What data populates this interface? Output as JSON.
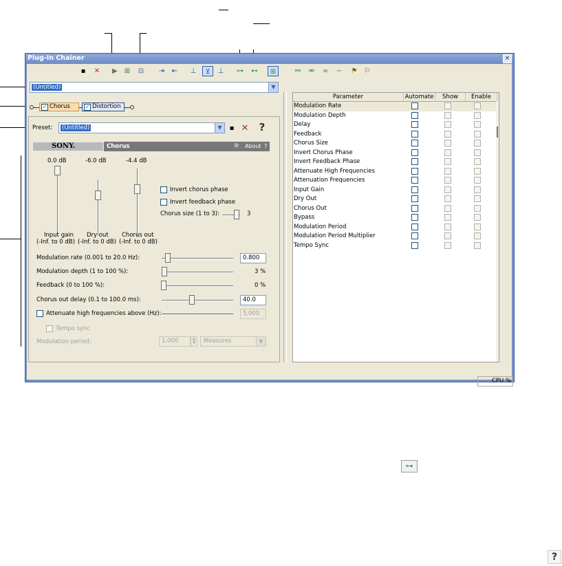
{
  "window": {
    "title": "Plug-In Chainer",
    "close": "×"
  },
  "chain": {
    "preset_value": "(Untitled)",
    "plugins": [
      {
        "label": "Chorus",
        "checked": true
      },
      {
        "label": "Distortion",
        "checked": true
      }
    ]
  },
  "preset": {
    "label": "Preset:",
    "value": "(Untitled)",
    "help": "?"
  },
  "plugin_header": {
    "brand": "SONY.",
    "name": "Chorus",
    "about": "About",
    "help": "?"
  },
  "faders": [
    {
      "value": "0.0 dB",
      "label1": "Input gain",
      "label2": "(-Inf. to 0 dB)"
    },
    {
      "value": "-6.0 dB",
      "label1": "Dry out",
      "label2": "(-Inf. to 0 dB)"
    },
    {
      "value": "-4.4 dB",
      "label1": "Chorus out",
      "label2": "(-Inf. to 0 dB)"
    }
  ],
  "options": {
    "invert_chorus": "Invert chorus phase",
    "invert_feedback": "Invert feedback phase",
    "chorus_size_label": "Chorus size (1 to 3):",
    "chorus_size_value": "3"
  },
  "params": {
    "mod_rate_label": "Modulation rate (0.001 to 20.0 Hz):",
    "mod_rate_value": "0.800",
    "mod_depth_label": "Modulation depth (1 to 100 %):",
    "mod_depth_value": "3 %",
    "feedback_label": "Feedback (0 to 100 %):",
    "feedback_value": "0 %",
    "delay_label": "Chorus out delay (0.1 to 100.0 ms):",
    "delay_value": "40.0",
    "attenuate_label": "Attenuate high frequencies above (Hz):",
    "attenuate_value": "5,000",
    "tempo_sync": "Tempo sync",
    "mod_period_label": "Modulation period:",
    "mod_period_value": "1.000",
    "mod_period_unit": "Measures"
  },
  "grid": {
    "headers": [
      "Parameter",
      "Automate",
      "Show",
      "Enable"
    ],
    "rows": [
      "Modulation Rate",
      "Modulation Depth",
      "Delay",
      "Feedback",
      "Chorus Size",
      "Invert Chorus Phase",
      "Invert Feedback Phase",
      "Attenuate High Frequencies",
      "Attenuation Frequencies",
      "Input Gain",
      "Dry Out",
      "Chorus Out",
      "Bypass",
      "Modulation Period",
      "Modulation Period Multiplier",
      "Tempo Sync"
    ]
  },
  "status": {
    "cpu": "CPU %"
  },
  "colors": {
    "accent": "#316ac5",
    "titlebar": "#7792c9",
    "plugin_header": "#777777"
  },
  "icons": [
    "save-icon",
    "delete-icon",
    "play-icon",
    "chain-icon",
    "help-icon",
    "route-icon"
  ]
}
